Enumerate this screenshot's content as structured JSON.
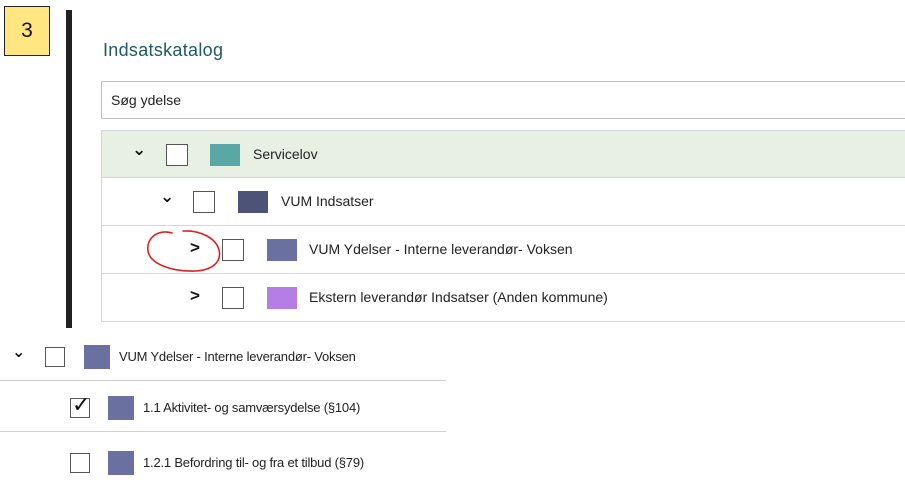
{
  "step_badge": "3",
  "catalog": {
    "title": "Indsatskatalog",
    "search_placeholder": "Søg ydelse"
  },
  "tree": [
    {
      "label": "Servicelov",
      "expanded": true,
      "checked": false,
      "swatch": "#5aa7a8",
      "level": 0
    },
    {
      "label": "VUM Indsatser",
      "expanded": true,
      "checked": false,
      "swatch": "#4d5378",
      "level": 1
    },
    {
      "label": "VUM Ydelser - Interne leverandør- Voksen",
      "expanded": false,
      "checked": false,
      "swatch": "#6a71a0",
      "level": 2
    },
    {
      "label": "Ekstern leverandør Indsatser (Anden kommune)",
      "expanded": false,
      "checked": false,
      "swatch": "#b57ee6",
      "level": 2
    }
  ],
  "lower_tree": [
    {
      "label": "VUM Ydelser - Interne leverandør- Voksen",
      "expanded": true,
      "checked": false,
      "swatch": "#6a71a0"
    },
    {
      "label": "1.1 Aktivitet- og samværsydelse (§104)",
      "checked": true,
      "swatch": "#6a71a0"
    },
    {
      "label": "1.2.1 Befordring til- og fra et tilbud (§79)",
      "checked": false,
      "swatch": "#6a71a0"
    }
  ],
  "icons": {
    "expanded": "chevron-down-icon",
    "collapsed": "chevron-right-icon"
  },
  "colors": {
    "title": "#1e5a66",
    "selected_row": "#e7f0e3",
    "annotation": "#e02020",
    "badge": "#ffe680"
  }
}
